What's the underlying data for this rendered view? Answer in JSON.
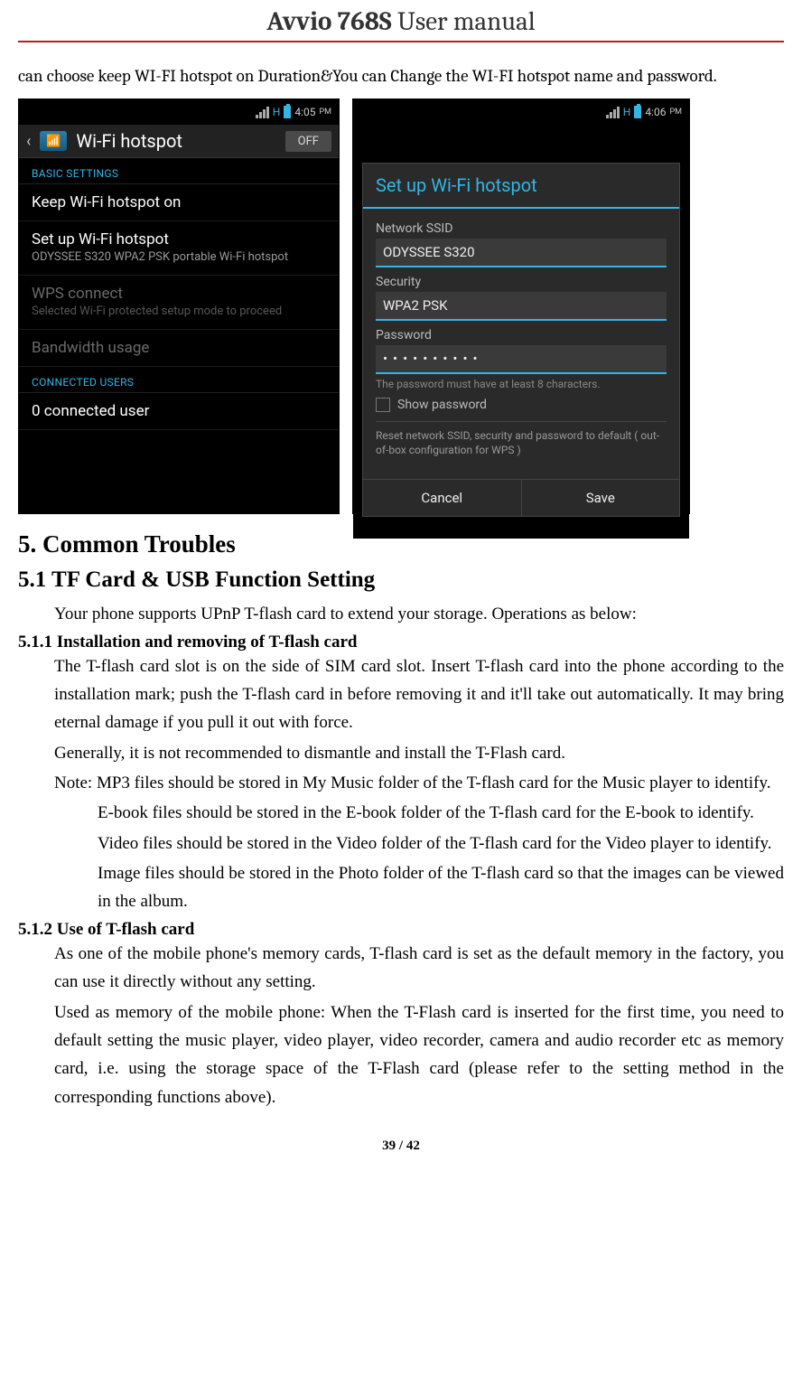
{
  "header": {
    "title_strong": "Avvio 768S",
    "title_light": " User manual"
  },
  "intro": "can choose keep WI-FI hotspot on Duration&You can Change the WI-FI hotspot name and password.",
  "phone1": {
    "time": "4:05",
    "ampm": "PM",
    "title": "Wi-Fi hotspot",
    "toggle": "OFF",
    "section_basic": "BASIC SETTINGS",
    "row_keep": "Keep Wi-Fi hotspot on",
    "row_setup_title": "Set up Wi-Fi hotspot",
    "row_setup_sub": "ODYSSEE S320 WPA2 PSK portable Wi-Fi hotspot",
    "row_wps_title": "WPS connect",
    "row_wps_sub": "Selected Wi-Fi protected setup mode to proceed",
    "row_band": "Bandwidth usage",
    "section_connected": "CONNECTED USERS",
    "row_users": "0 connected user"
  },
  "phone2": {
    "time": "4:06",
    "ampm": "PM",
    "dlg_title": "Set up Wi-Fi hotspot",
    "lbl_ssid": "Network SSID",
    "val_ssid": "ODYSSEE S320",
    "lbl_security": "Security",
    "val_security": "WPA2 PSK",
    "lbl_password": "Password",
    "val_password": "••••••••••",
    "pw_hint": "The password must have at least 8 characters.",
    "show_pw": "Show password",
    "reset_txt": "Reset network SSID, security and password to default ( out-of-box configuration for WPS )",
    "btn_cancel": "Cancel",
    "btn_save": "Save"
  },
  "sections": {
    "h2": "5. Common Troubles",
    "h3": "5.1 TF Card & USB Function Setting",
    "p1": "Your phone supports UPnP T-flash card to extend your storage. Operations as below:",
    "h4a": "5.1.1 Installation and removing of T-flash card",
    "p2": "The T-flash card slot is on the side of SIM card slot. Insert T-flash card into the phone according to the installation mark; push the T-flash card in before removing it and it'll take out automatically. It may bring eternal damage if you pull it out with force.",
    "p3": "Generally, it is not recommended to dismantle and install the T-Flash card.",
    "note1": "Note: MP3 files should be stored in My Music folder of the T-flash card for the Music player to identify.",
    "note2": "E-book files should be stored in the E-book folder of the T-flash card for the E-book to identify.",
    "note3": "Video files should be stored in the Video folder of the T-flash card for the Video player to identify.",
    "note4": "Image files should be stored in the Photo folder of the T-flash card so that the images can be viewed in the album.",
    "h4b": "5.1.2 Use of T-flash card",
    "p4": "As one of the mobile phone's memory cards, T-flash card is set as the default memory in the factory, you can use it directly without any setting.",
    "p5": "Used as memory of the mobile phone: When the T-Flash card is inserted for the first time, you need to default setting the music player, video player, video recorder, camera and audio recorder etc as memory card, i.e. using the storage space of the T-Flash card (please refer to the setting method in the corresponding functions above)."
  },
  "footer": {
    "page": "39 / 42"
  }
}
